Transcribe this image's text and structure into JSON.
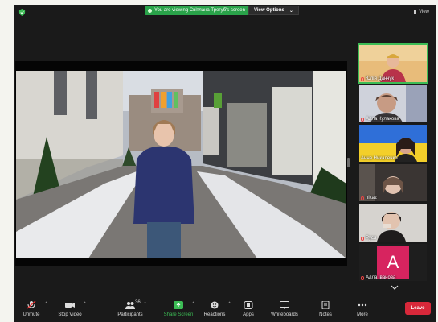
{
  "share_banner": {
    "message": "You are viewing Світлана Трегуб's screen",
    "options_label": "View Options"
  },
  "view_button_label": "View",
  "participants": [
    {
      "name": "Юлія Данчук",
      "active": true
    },
    {
      "name": "Алла Кулакова",
      "active": false
    },
    {
      "name": "Анна Никаленко",
      "active": false
    },
    {
      "name": "nikaz",
      "active": false
    },
    {
      "name": "Руся",
      "active": false
    },
    {
      "name": "Алла Іванова",
      "avatar_letter": "A",
      "active": false
    }
  ],
  "toolbar": {
    "mute": "Unmute",
    "video": "Stop Video",
    "participants": "Participants",
    "participants_count": "36",
    "share": "Share Screen",
    "reactions": "Reactions",
    "apps": "Apps",
    "whiteboards": "Whiteboards",
    "notes": "Notes",
    "more": "More",
    "leave": "Leave"
  },
  "colors": {
    "share_green": "#2aa34a",
    "active_border": "#3cbc55",
    "leave_red": "#d8283a",
    "avatar_pink": "#d7245f"
  }
}
